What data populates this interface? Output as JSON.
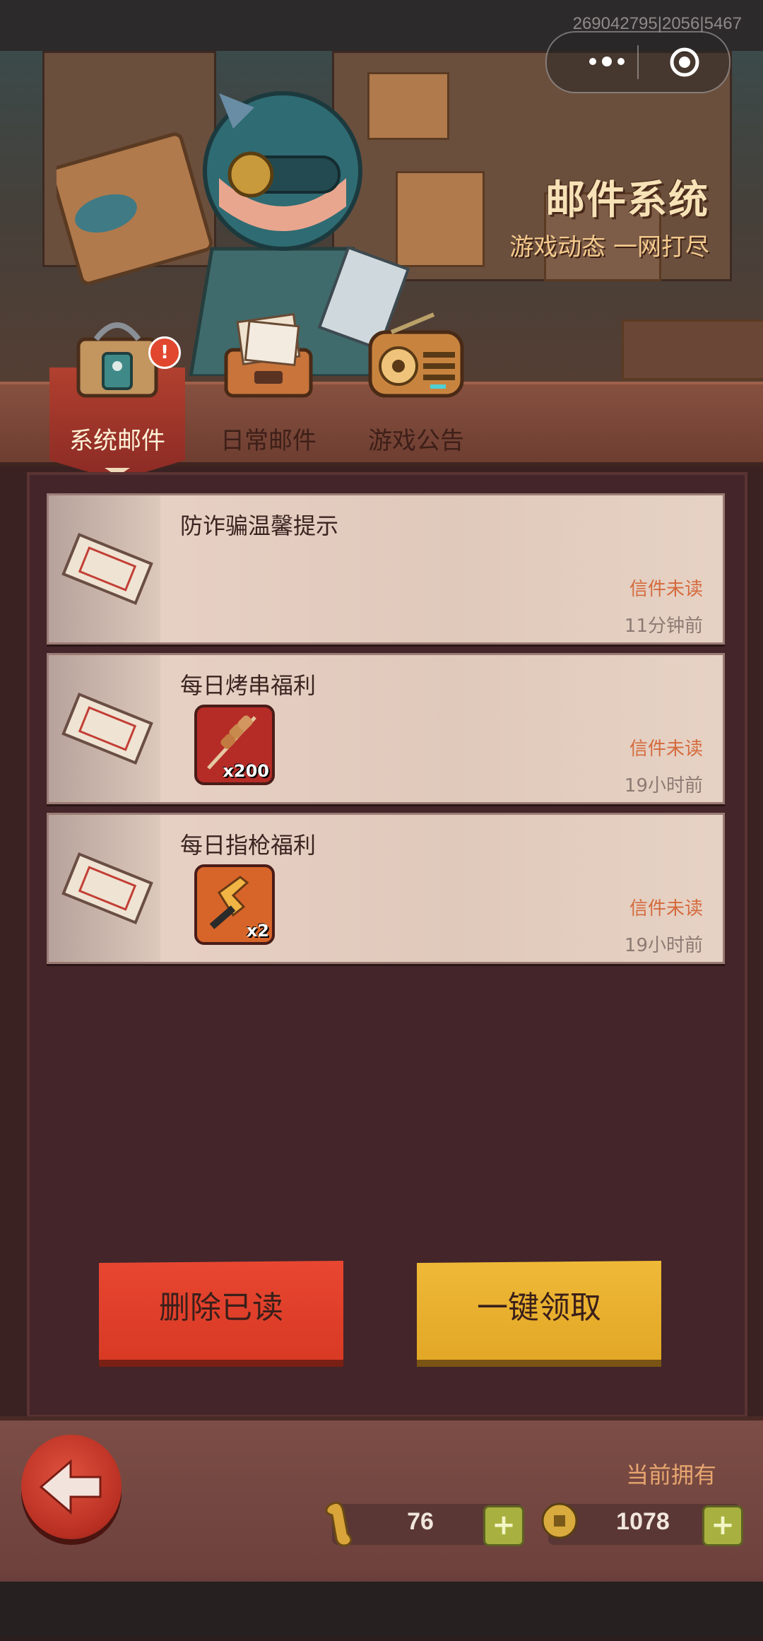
{
  "status": {
    "build_id": "269042795|2056|5467"
  },
  "capsule": {
    "more_icon": "more-dots-icon",
    "close_icon": "target-circle-icon"
  },
  "banner": {
    "title": "邮件系统",
    "subtitle": "游戏动态 一网打尽"
  },
  "tabs": [
    {
      "label": "系统邮件",
      "icon": "mailbag-icon",
      "active": true,
      "badge": "!"
    },
    {
      "label": "日常邮件",
      "icon": "letter-tray-icon",
      "active": false
    },
    {
      "label": "游戏公告",
      "icon": "radio-icon",
      "active": false
    }
  ],
  "mails": [
    {
      "title": "防诈骗温馨提示",
      "status": "信件未读",
      "time": "11分钟前",
      "icon": "envelope-icon"
    },
    {
      "title": "每日烤串福利",
      "status": "信件未读",
      "time": "19小时前",
      "icon": "envelope-icon",
      "reward": {
        "icon": "skewer-icon",
        "qty": "x200",
        "color": "#b52c27"
      }
    },
    {
      "title": "每日指枪福利",
      "status": "信件未读",
      "time": "19小时前",
      "icon": "envelope-icon",
      "reward": {
        "icon": "finger-gun-icon",
        "qty": "x2",
        "color": "#d7652a"
      }
    }
  ],
  "actions": {
    "delete_read": "删除已读",
    "claim_all": "一键领取"
  },
  "footer": {
    "owned_label": "当前拥有",
    "back_icon": "back-arrow-icon",
    "currencies": [
      {
        "icon": "bone-icon",
        "value": "76",
        "add_icon": "plus-icon"
      },
      {
        "icon": "coin-icon",
        "value": "1078",
        "add_icon": "plus-icon"
      }
    ]
  },
  "colors": {
    "accent_red": "#e84631",
    "accent_yellow": "#efb937",
    "unread": "#d56a3d"
  }
}
